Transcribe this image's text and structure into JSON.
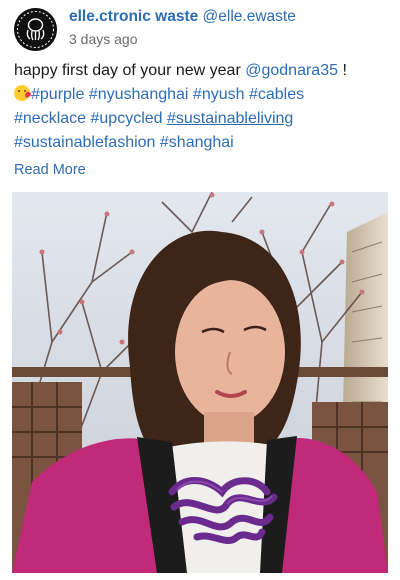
{
  "post": {
    "account_name": "elle.ctronic waste",
    "handle": "@elle.ewaste",
    "time": "3 days ago",
    "caption": {
      "line1_text": "happy first day of your new year ",
      "mention": "@godnara35",
      "line1_end": " !",
      "hashtags_row1": [
        "#purple",
        "#nyushanghai",
        "#nyush",
        "#cables"
      ],
      "hashtags_row2": [
        "#necklace",
        "#upcycled",
        "#sustainableliving"
      ],
      "hashtags_row3": [
        "#sustainablefashion",
        "#shanghai"
      ]
    },
    "read_more": "Read More",
    "image": {
      "colors": {
        "sky": "#d8dde6",
        "jacket": "#c02a78",
        "necklace": "#6a2a8e",
        "hair": "#3d2618"
      }
    }
  },
  "icons": {
    "avatar": "octopus-logo-icon",
    "emoji": "kissing-face-emoji-icon"
  }
}
